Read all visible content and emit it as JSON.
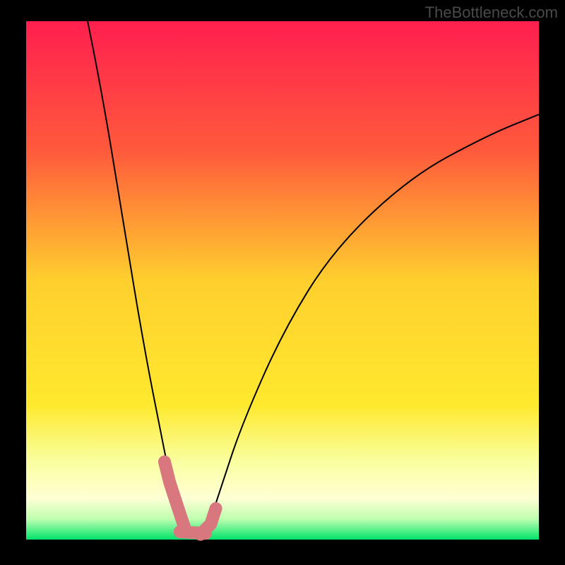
{
  "watermark": "TheBottleneck.com",
  "chart_data": {
    "type": "line",
    "title": "",
    "xlabel": "",
    "ylabel": "",
    "x_range_pct": [
      0,
      100
    ],
    "y_range_pct": [
      0,
      100
    ],
    "bottleneck_percentage": {
      "optimum_x_pct": 32,
      "description": "V-shaped bottleneck curve. Y represents bottleneck severity percentage from green (0, none) near bottom to red (100, severe) near top. X represents the ratio of component performance. Minimum near x≈32%.",
      "x_pct": [
        12,
        14,
        16,
        18,
        20,
        22,
        24,
        26,
        28,
        30,
        32,
        34,
        36,
        38,
        42,
        50,
        60,
        75,
        90,
        100
      ],
      "y_pct": [
        100,
        90,
        79,
        67,
        55,
        43,
        32,
        22,
        12,
        5,
        1,
        1,
        4,
        10,
        22,
        40,
        56,
        70,
        78,
        82
      ]
    },
    "highlighted_segment": {
      "description": "Salmon/pink thick rounded markers overlaying the near-zero (bottom) region of the curve around the optimum.",
      "x_pct": [
        27,
        28,
        29,
        30,
        31,
        34,
        35,
        36,
        37
      ],
      "y_pct": [
        15,
        11,
        8,
        5,
        2,
        1,
        2,
        3,
        6
      ]
    },
    "background_gradient": {
      "description": "Vertical gradient mapping bottleneck severity to color inside the plot area.",
      "stops": [
        {
          "pos_pct": 0,
          "color": "#ff1f4f",
          "meaning": "severe"
        },
        {
          "pos_pct": 25,
          "color": "#ff5a3c"
        },
        {
          "pos_pct": 50,
          "color": "#ffcf2e"
        },
        {
          "pos_pct": 74,
          "color": "#ffe92e"
        },
        {
          "pos_pct": 85,
          "color": "#f9ffa0"
        },
        {
          "pos_pct": 92,
          "color": "#ffffd4"
        },
        {
          "pos_pct": 96,
          "color": "#bfffb0"
        },
        {
          "pos_pct": 100,
          "color": "#00e36b",
          "meaning": "none"
        }
      ]
    }
  }
}
